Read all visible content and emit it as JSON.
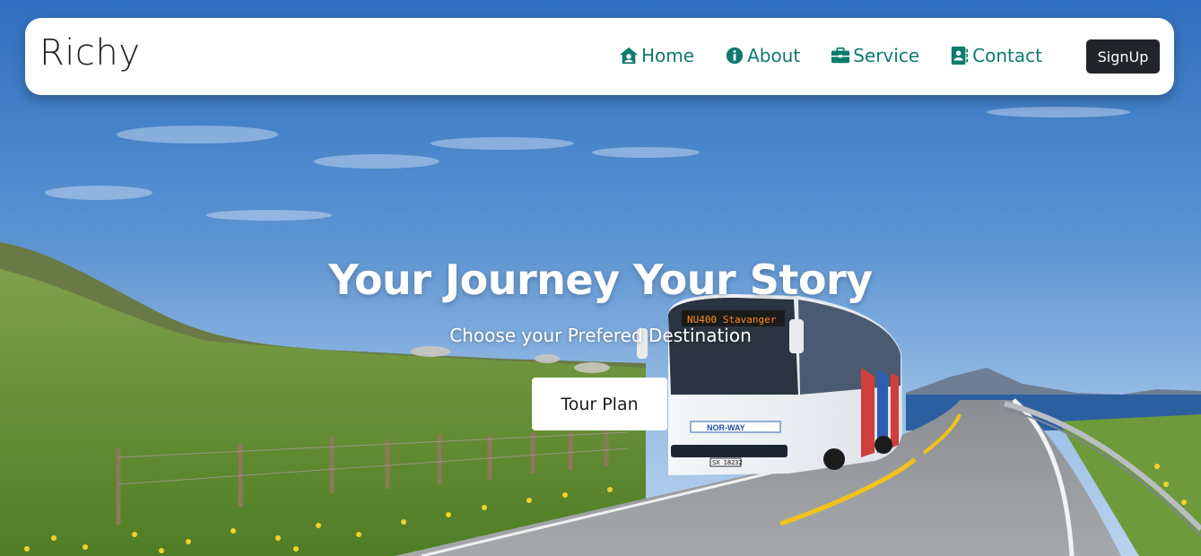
{
  "brand": "Richy",
  "nav": {
    "items": [
      {
        "label": "Home",
        "icon": "home-icon"
      },
      {
        "label": "About",
        "icon": "info-icon"
      },
      {
        "label": "Service",
        "icon": "briefcase-icon"
      },
      {
        "label": "Contact",
        "icon": "contact-book-icon"
      }
    ],
    "signup_label": "SignUp"
  },
  "hero": {
    "title": "Your Journey Your Story",
    "subtitle": "Choose your Prefered Destination",
    "cta_label": "Tour Plan",
    "bus_sign": "NU400  Stavanger",
    "bus_brand": "NOR-WAY",
    "bus_plate": "SX 18232"
  },
  "colors": {
    "accent": "#0f7a6e",
    "signup_bg": "#212529",
    "sky": "#3f7fc8"
  }
}
